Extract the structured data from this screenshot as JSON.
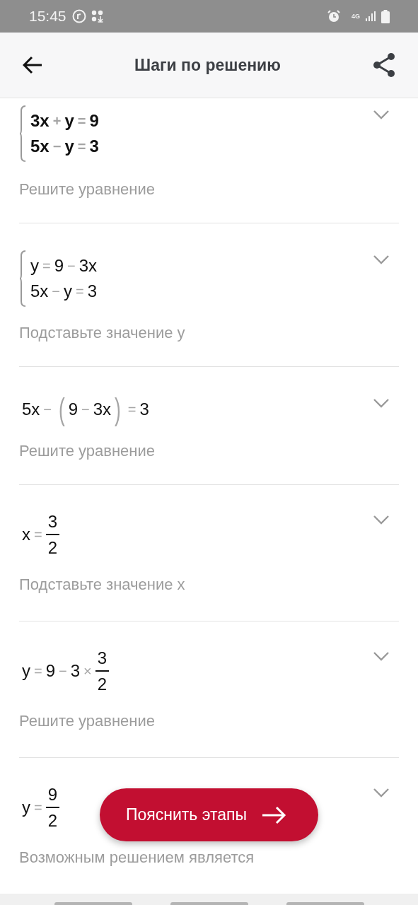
{
  "status_bar": {
    "time": "15:45",
    "network_type": "4G"
  },
  "app_bar": {
    "title": "Шаги по решению"
  },
  "steps": [
    {
      "kind": "system",
      "bold": true,
      "lines": [
        [
          {
            "kind": "term",
            "text": "3x"
          },
          {
            "kind": "op",
            "text": "+"
          },
          {
            "kind": "term",
            "text": "y"
          },
          {
            "kind": "op",
            "text": "="
          },
          {
            "kind": "term",
            "text": "9"
          }
        ],
        [
          {
            "kind": "term",
            "text": "5x"
          },
          {
            "kind": "op",
            "text": "−"
          },
          {
            "kind": "term",
            "text": "y"
          },
          {
            "kind": "op",
            "text": "="
          },
          {
            "kind": "term",
            "text": "3"
          }
        ]
      ],
      "description": "Решите уравнение"
    },
    {
      "kind": "system",
      "bold": false,
      "lines": [
        [
          {
            "kind": "term",
            "text": "y"
          },
          {
            "kind": "op",
            "text": "="
          },
          {
            "kind": "term",
            "text": "9"
          },
          {
            "kind": "op",
            "text": "−"
          },
          {
            "kind": "term",
            "text": "3x"
          }
        ],
        [
          {
            "kind": "term",
            "text": "5x"
          },
          {
            "kind": "op",
            "text": "−"
          },
          {
            "kind": "term",
            "text": "y"
          },
          {
            "kind": "op",
            "text": "="
          },
          {
            "kind": "term",
            "text": "3"
          }
        ]
      ],
      "description": "Подставьте значение y"
    },
    {
      "kind": "line",
      "bold": false,
      "lines": [
        [
          {
            "kind": "term",
            "text": "5x"
          },
          {
            "kind": "op",
            "text": "−"
          },
          {
            "kind": "paren",
            "text": "("
          },
          {
            "kind": "term",
            "text": "9"
          },
          {
            "kind": "op",
            "text": "−"
          },
          {
            "kind": "term",
            "text": "3x"
          },
          {
            "kind": "paren",
            "text": ")"
          },
          {
            "kind": "op",
            "text": "="
          },
          {
            "kind": "term",
            "text": "3"
          }
        ]
      ],
      "description": "Решите уравнение"
    },
    {
      "kind": "line",
      "bold": false,
      "lines": [
        [
          {
            "kind": "term",
            "text": "x"
          },
          {
            "kind": "op",
            "text": "="
          },
          {
            "kind": "frac",
            "num": "3",
            "den": "2"
          }
        ]
      ],
      "description": "Подставьте значение x"
    },
    {
      "kind": "line",
      "bold": false,
      "lines": [
        [
          {
            "kind": "term",
            "text": "y"
          },
          {
            "kind": "op",
            "text": "="
          },
          {
            "kind": "term",
            "text": "9"
          },
          {
            "kind": "op",
            "text": "−"
          },
          {
            "kind": "term",
            "text": "3"
          },
          {
            "kind": "op",
            "text": "×"
          },
          {
            "kind": "frac",
            "num": "3",
            "den": "2"
          }
        ]
      ],
      "description": "Решите уравнение"
    },
    {
      "kind": "line",
      "bold": false,
      "lines": [
        [
          {
            "kind": "term",
            "text": "y"
          },
          {
            "kind": "op",
            "text": "="
          },
          {
            "kind": "frac",
            "num": "9",
            "den": "2"
          }
        ]
      ],
      "description": "Возможным решением является"
    }
  ],
  "fab": {
    "label": "Пояснить этапы"
  }
}
